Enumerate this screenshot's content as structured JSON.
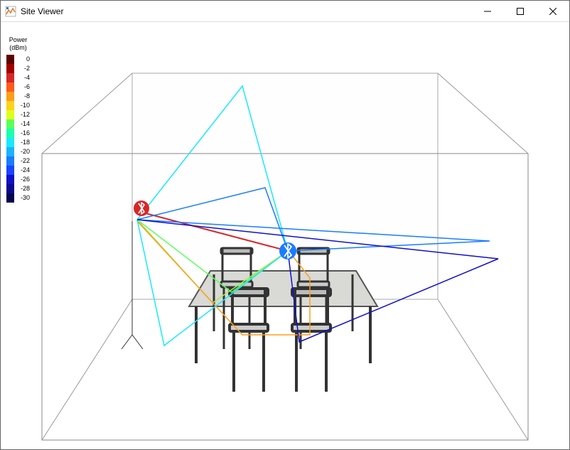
{
  "window": {
    "title": "Site Viewer"
  },
  "legend": {
    "title_line1": "Power",
    "title_line2": "(dBm)",
    "entries": [
      {
        "value": "0",
        "color": "#5f0000"
      },
      {
        "value": "-2",
        "color": "#a00000"
      },
      {
        "value": "-4",
        "color": "#d62728"
      },
      {
        "value": "-6",
        "color": "#ff5a1a"
      },
      {
        "value": "-8",
        "color": "#ff9d1a"
      },
      {
        "value": "-10",
        "color": "#ffd21a"
      },
      {
        "value": "-12",
        "color": "#dfff1a"
      },
      {
        "value": "-14",
        "color": "#5cff5c"
      },
      {
        "value": "-16",
        "color": "#1affb0"
      },
      {
        "value": "-18",
        "color": "#1ae8ff"
      },
      {
        "value": "-20",
        "color": "#1ab4ff"
      },
      {
        "value": "-22",
        "color": "#1a7cff"
      },
      {
        "value": "-24",
        "color": "#1a44ff"
      },
      {
        "value": "-26",
        "color": "#1010c8"
      },
      {
        "value": "-28",
        "color": "#0a0a8c"
      },
      {
        "value": "-30",
        "color": "#050550"
      }
    ]
  },
  "markers": {
    "tx": {
      "name": "bluetooth-tx",
      "color": "#d62728"
    },
    "rx": {
      "name": "bluetooth-rx",
      "color": "#1a7cff"
    }
  },
  "chart_data": {
    "type": "3d-raytrace",
    "title": "Site Viewer — propagation rays colored by received power (dBm)",
    "colorbar_label": "Power (dBm)",
    "color_range": [
      -30,
      0
    ],
    "transmitter": {
      "approx_pos": "left wall, mid-height"
    },
    "receiver": {
      "approx_pos": "above table center"
    },
    "rays": [
      {
        "bounces": 0,
        "approx_power_dBm": -4,
        "note": "direct LOS ray"
      },
      {
        "bounces": 1,
        "approx_power_dBm": -14,
        "note": "floor/table reflection (green)"
      },
      {
        "bounces": 1,
        "approx_power_dBm": -12,
        "note": "floor reflection (yellow-green)"
      },
      {
        "bounces": 1,
        "approx_power_dBm": -8,
        "note": "floor bounce near table (orange)"
      },
      {
        "bounces": 1,
        "approx_power_dBm": -18,
        "note": "ceiling reflection (cyan)"
      },
      {
        "bounces": 1,
        "approx_power_dBm": -18,
        "note": "floor reflection (cyan)"
      },
      {
        "bounces": 1,
        "approx_power_dBm": -22,
        "note": "right-wall reflection upper (blue)"
      },
      {
        "bounces": 1,
        "approx_power_dBm": -22,
        "note": "front-wall short bounce (blue)"
      },
      {
        "bounces": 2,
        "approx_power_dBm": -26,
        "note": "right-wall + floor double bounce (dark blue)"
      }
    ]
  }
}
